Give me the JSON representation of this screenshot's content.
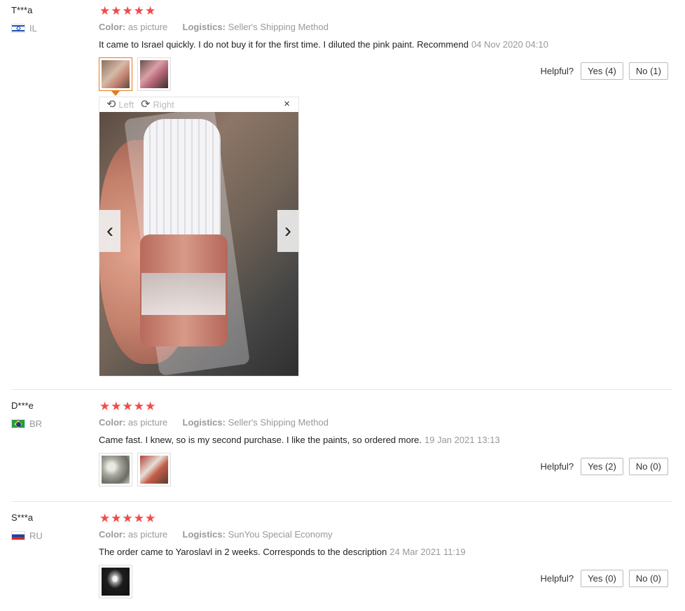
{
  "reviews": [
    {
      "user": "T***a",
      "country": "IL",
      "stars": "★★★★★",
      "color_label": "Color:",
      "color_value": "as picture",
      "logistics_label": "Logistics:",
      "logistics_value": "Seller's Shipping Method",
      "text": "It came to Israel quickly. I do not buy it for the first time. I diluted the pink paint. Recommend",
      "date": "04 Nov 2020 04:10",
      "helpful_label": "Helpful?",
      "yes": "Yes (4)",
      "no": "No (1)"
    },
    {
      "user": "D***e",
      "country": "BR",
      "stars": "★★★★★",
      "color_label": "Color:",
      "color_value": "as picture",
      "logistics_label": "Logistics:",
      "logistics_value": "Seller's Shipping Method",
      "text": "Came fast. I knew, so is my second purchase. I like the paints, so ordered more.",
      "date": "19 Jan 2021 13:13",
      "helpful_label": "Helpful?",
      "yes": "Yes (2)",
      "no": "No (0)"
    },
    {
      "user": "S***a",
      "country": "RU",
      "stars": "★★★★★",
      "color_label": "Color:",
      "color_value": "as picture",
      "logistics_label": "Logistics:",
      "logistics_value": "SunYou Special Economy",
      "text": "The order came to Yaroslavl in 2 weeks. Corresponds to the description",
      "date": "24 Mar 2021 11:19",
      "helpful_label": "Helpful?",
      "yes": "Yes (0)",
      "no": "No (0)"
    }
  ],
  "viewer": {
    "left_label": "Left",
    "right_label": "Right",
    "close": "×",
    "prev": "‹",
    "next": "›"
  },
  "colors": {
    "star": "#f04a4a",
    "active_thumb_border": "#e77a1b",
    "muted_text": "#999999"
  }
}
